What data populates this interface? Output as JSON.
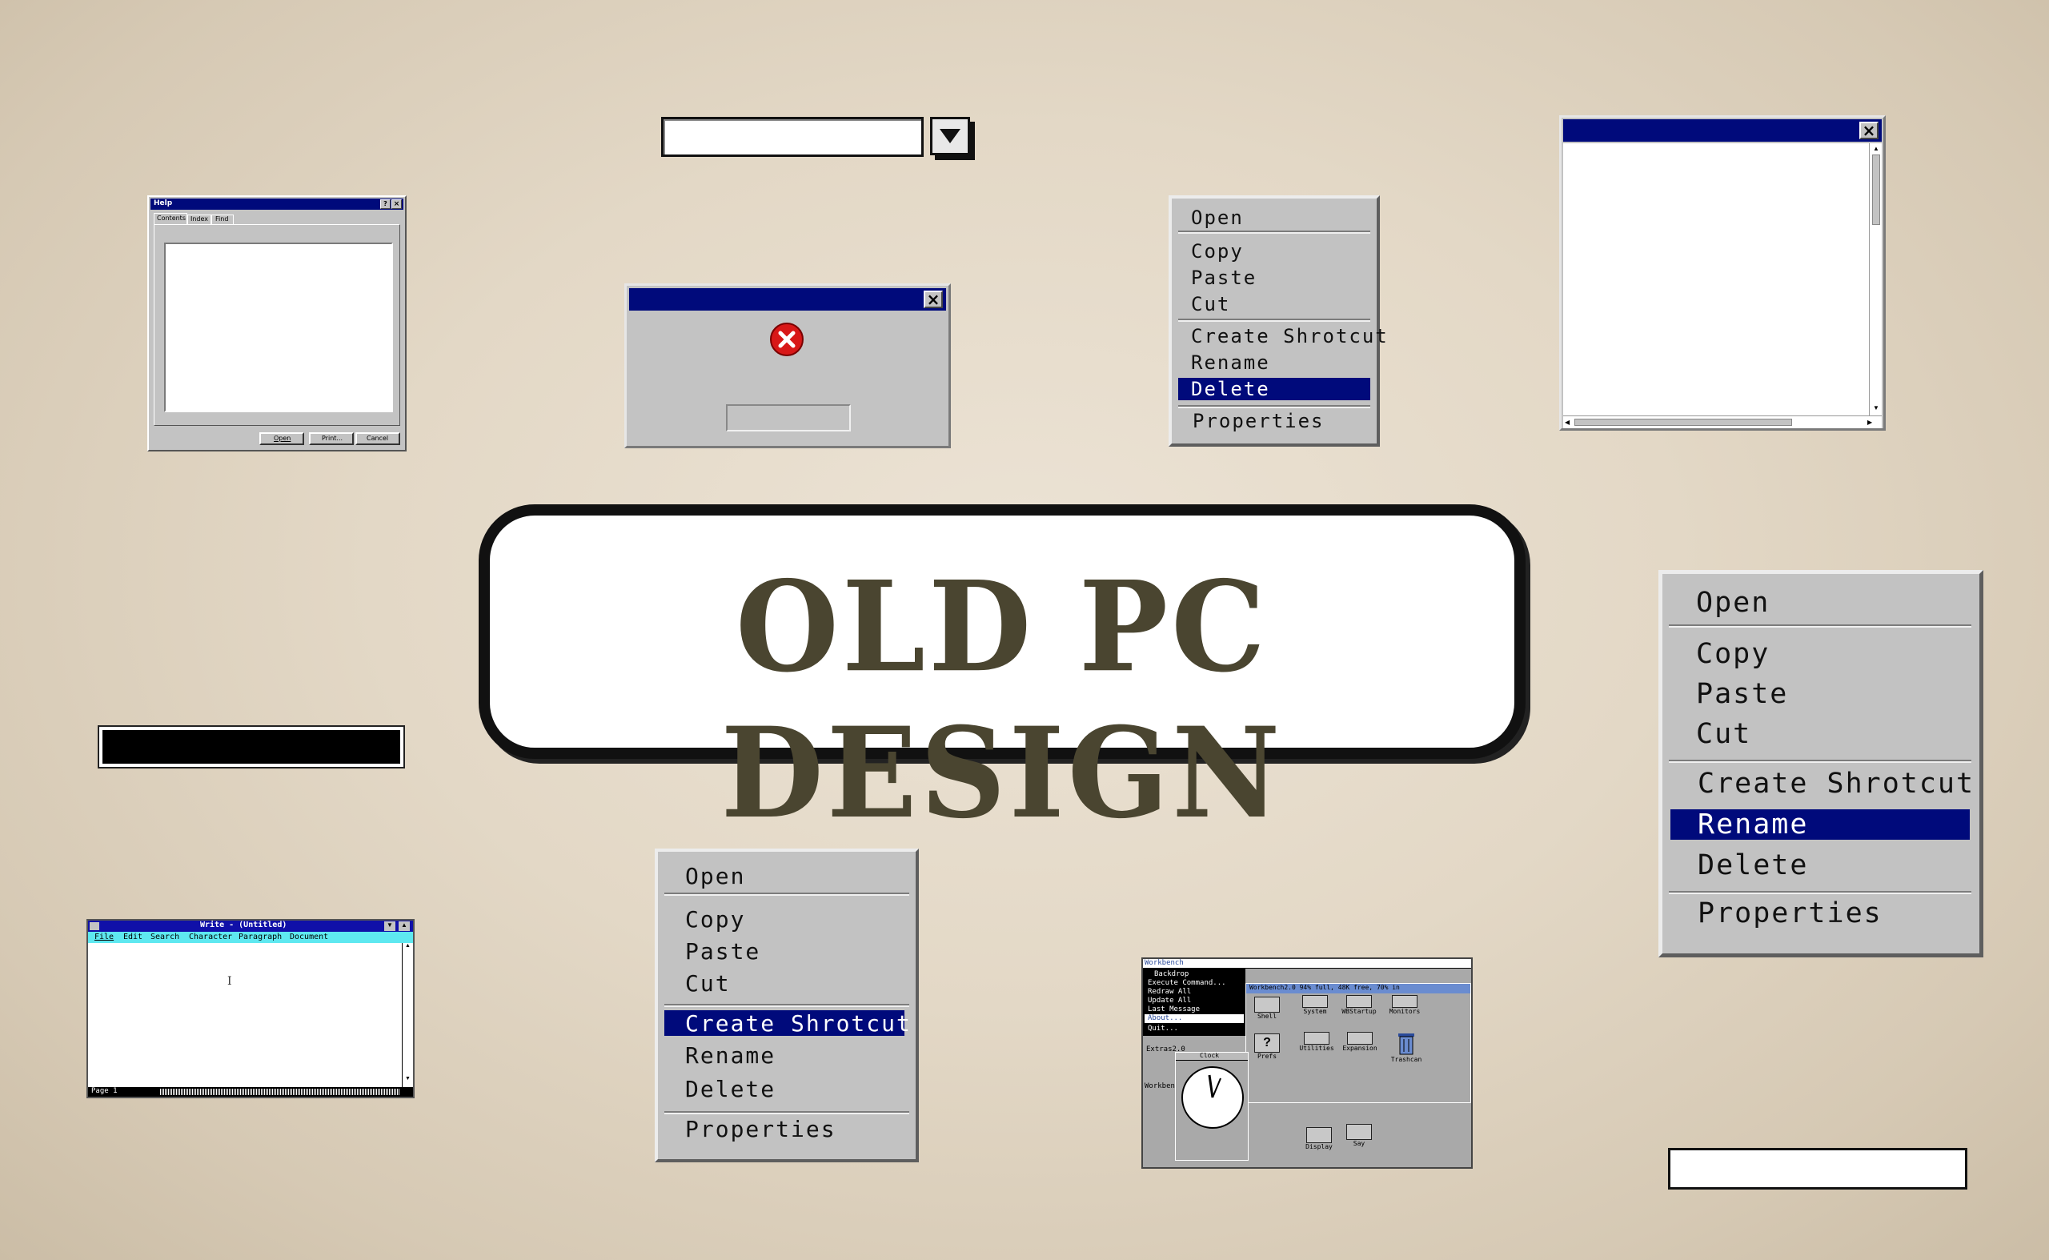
{
  "title": "OLD PC DESIGN",
  "help_window": {
    "title": "Help",
    "title_buttons": [
      "?",
      "×"
    ],
    "tabs": [
      "Contents",
      "Index",
      "Find"
    ],
    "buttons": [
      "Open",
      "Print...",
      "Cancel"
    ]
  },
  "dropdown": {
    "value": "",
    "arrow_icon": "triangle-down-icon"
  },
  "error_dialog": {
    "close": "×",
    "icon": "error-x-icon",
    "button_label": ""
  },
  "context_menu_small": {
    "groups": [
      [
        "Open"
      ],
      [
        "Copy",
        "Paste",
        "Cut"
      ],
      [
        "Create Shrotcut",
        "Rename",
        "Delete"
      ],
      [
        "Properties"
      ]
    ],
    "selected": "Delete"
  },
  "context_menu_center": {
    "groups": [
      [
        "Open"
      ],
      [
        "Copy",
        "Paste",
        "Cut"
      ],
      [
        "Create Shrotcut",
        "Rename",
        "Delete"
      ],
      [
        "Properties"
      ]
    ],
    "selected": "Create Shrotcut"
  },
  "context_menu_large": {
    "groups": [
      [
        "Open"
      ],
      [
        "Copy",
        "Paste",
        "Cut"
      ],
      [
        "Create Shrotcut",
        "Rename",
        "Delete"
      ],
      [
        "Properties"
      ]
    ],
    "selected": "Rename"
  },
  "blank_window": {
    "close": "×"
  },
  "write_window": {
    "title": "Write - (Untitled)",
    "menu": [
      "File",
      "Edit",
      "Search",
      "Character",
      "Paragraph",
      "Document"
    ],
    "status": "Page 1",
    "cursor": "I"
  },
  "workbench": {
    "menubar": "Workbench",
    "menu_items": [
      "Backdrop",
      "Execute Command...",
      "Redraw All",
      "Update All",
      "Last Message",
      "About...",
      "Quit..."
    ],
    "window_title": "Workbench2.0  94% full, 48K free, 70% in",
    "icons": [
      "Shell",
      "System",
      "WBStartup",
      "Monitors",
      "Prefs",
      "Utilities",
      "Expansion",
      "Trashcan",
      "Display",
      "Say"
    ],
    "side_labels": [
      "Extras2.0",
      "Workben"
    ],
    "clock_title": "Clock"
  },
  "colors": {
    "titlebar": "#000a7b",
    "menu_bg": "#c2c2c2",
    "title_text": "#4a4530",
    "paper": "#e6dccb"
  }
}
